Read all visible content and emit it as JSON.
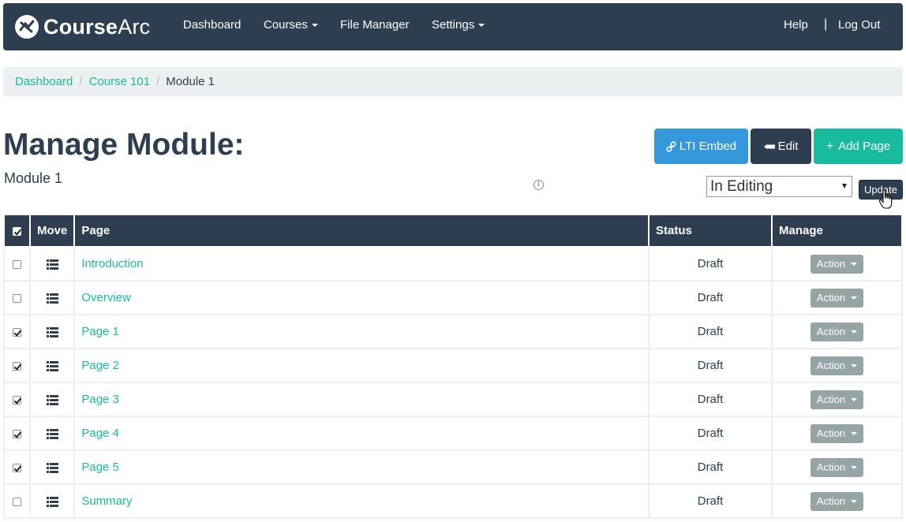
{
  "brand": {
    "name_bold": "Course",
    "name_light": "Arc"
  },
  "nav": {
    "items": [
      {
        "label": "Dashboard"
      },
      {
        "label": "Courses"
      },
      {
        "label": "File Manager"
      },
      {
        "label": "Settings"
      }
    ],
    "help": "Help",
    "separator": "|",
    "logout": "Log Out"
  },
  "breadcrumb": {
    "items": [
      "Dashboard",
      "Course 101"
    ],
    "separator": "/",
    "active": "Module 1"
  },
  "header": {
    "title": "Manage Module:",
    "subtitle": "Module 1",
    "info": "i",
    "buttons": {
      "lti": "LTI Embed",
      "edit": "Edit",
      "add": "Add Page"
    },
    "status_select": "In Editing",
    "update": "Update"
  },
  "table": {
    "columns": [
      "Move",
      "Page",
      "Status",
      "Manage"
    ],
    "rows": [
      {
        "checked": false,
        "page": "Introduction",
        "status": "Draft",
        "action": "Action"
      },
      {
        "checked": false,
        "page": "Overview",
        "status": "Draft",
        "action": "Action"
      },
      {
        "checked": true,
        "page": "Page 1",
        "status": "Draft",
        "action": "Action"
      },
      {
        "checked": true,
        "page": "Page 2",
        "status": "Draft",
        "action": "Action"
      },
      {
        "checked": true,
        "page": "Page 3",
        "status": "Draft",
        "action": "Action"
      },
      {
        "checked": true,
        "page": "Page 4",
        "status": "Draft",
        "action": "Action"
      },
      {
        "checked": true,
        "page": "Page 5",
        "status": "Draft",
        "action": "Action"
      },
      {
        "checked": false,
        "page": "Summary",
        "status": "Draft",
        "action": "Action"
      }
    ]
  },
  "colors": {
    "navbar": "#2c3e50",
    "link": "#18bc9c",
    "lti_button": "#3498db",
    "add_button": "#18bc9c",
    "action_button": "#95a5a6"
  }
}
